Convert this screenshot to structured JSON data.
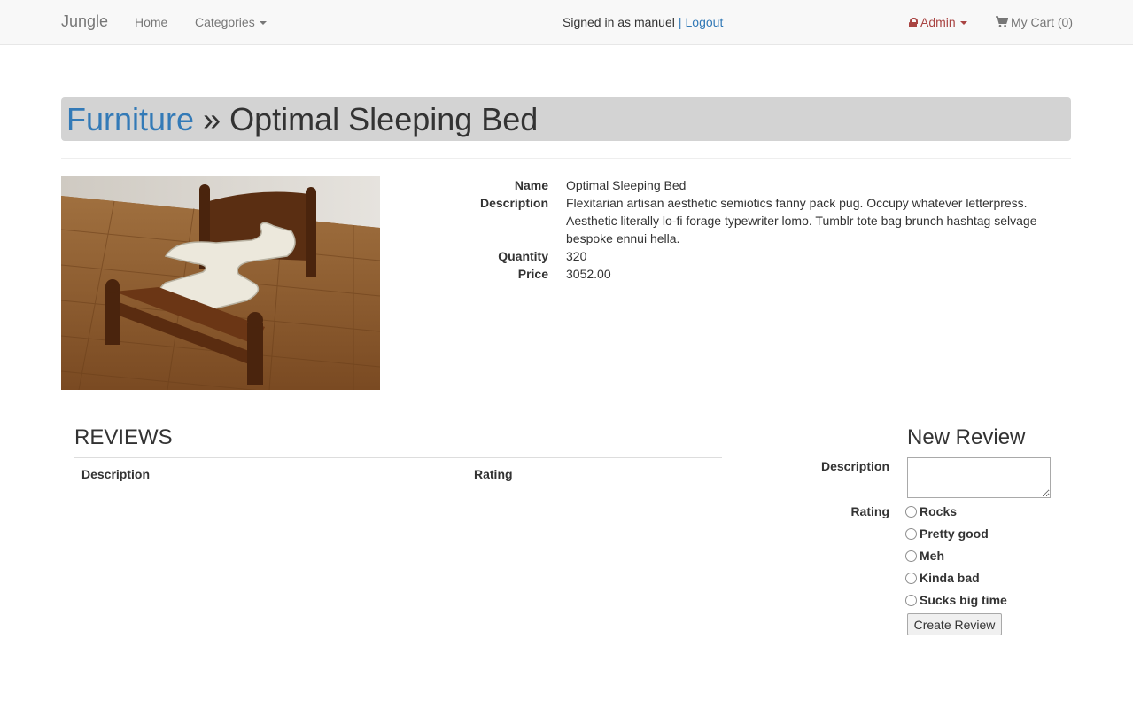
{
  "navbar": {
    "brand": "Jungle",
    "home": "Home",
    "categories": "Categories",
    "signed_in": "Signed in as manuel",
    "separator": "|",
    "logout": "Logout",
    "admin": "Admin",
    "cart": "My Cart (0)"
  },
  "title": {
    "category": "Furniture",
    "separator": "»",
    "product": "Optimal Sleeping Bed"
  },
  "details": {
    "name_label": "Name",
    "name": "Optimal Sleeping Bed",
    "description_label": "Description",
    "description": "Flexitarian artisan aesthetic semiotics fanny pack pug. Occupy whatever letterpress. Aesthetic literally lo-fi forage typewriter lomo. Tumblr tote bag brunch hashtag selvage bespoke ennui hella.",
    "quantity_label": "Quantity",
    "quantity": "320",
    "price_label": "Price",
    "price": "3052.00"
  },
  "reviews": {
    "heading": "REVIEWS",
    "col_description": "Description",
    "col_rating": "Rating"
  },
  "new_review": {
    "heading": "New Review",
    "description_label": "Description",
    "rating_label": "Rating",
    "options": [
      "Rocks",
      "Pretty good",
      "Meh",
      "Kinda bad",
      "Sucks big time"
    ],
    "submit": "Create Review"
  },
  "colors": {
    "link": "#337ab7",
    "admin": "#a94442",
    "title_bg": "#d3d3d3"
  },
  "icons": {
    "admin": "lock-icon",
    "cart": "shopping-cart-icon"
  }
}
